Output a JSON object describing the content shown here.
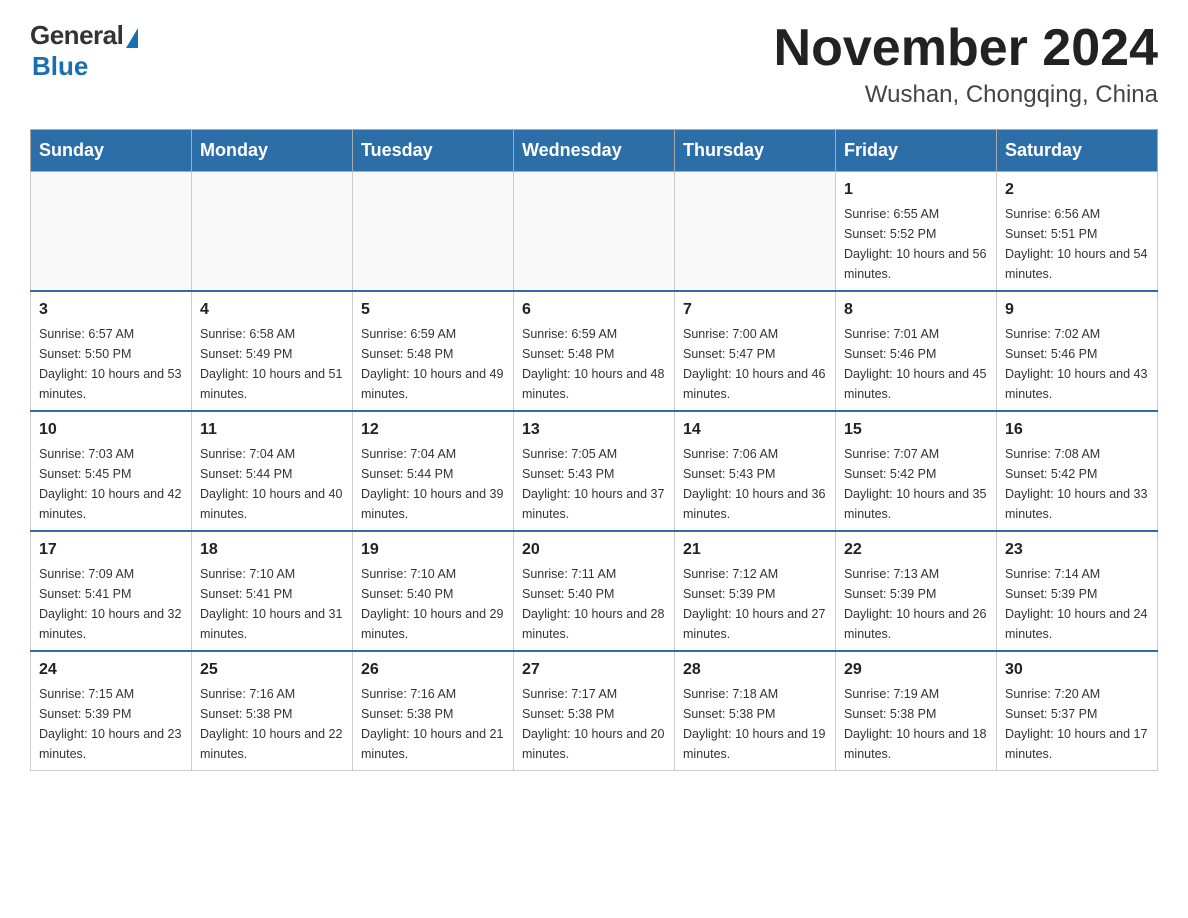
{
  "header": {
    "logo_general": "General",
    "logo_blue": "Blue",
    "month_year": "November 2024",
    "location": "Wushan, Chongqing, China"
  },
  "days_of_week": [
    "Sunday",
    "Monday",
    "Tuesday",
    "Wednesday",
    "Thursday",
    "Friday",
    "Saturday"
  ],
  "weeks": [
    [
      {
        "day": "",
        "info": ""
      },
      {
        "day": "",
        "info": ""
      },
      {
        "day": "",
        "info": ""
      },
      {
        "day": "",
        "info": ""
      },
      {
        "day": "",
        "info": ""
      },
      {
        "day": "1",
        "info": "Sunrise: 6:55 AM\nSunset: 5:52 PM\nDaylight: 10 hours and 56 minutes."
      },
      {
        "day": "2",
        "info": "Sunrise: 6:56 AM\nSunset: 5:51 PM\nDaylight: 10 hours and 54 minutes."
      }
    ],
    [
      {
        "day": "3",
        "info": "Sunrise: 6:57 AM\nSunset: 5:50 PM\nDaylight: 10 hours and 53 minutes."
      },
      {
        "day": "4",
        "info": "Sunrise: 6:58 AM\nSunset: 5:49 PM\nDaylight: 10 hours and 51 minutes."
      },
      {
        "day": "5",
        "info": "Sunrise: 6:59 AM\nSunset: 5:48 PM\nDaylight: 10 hours and 49 minutes."
      },
      {
        "day": "6",
        "info": "Sunrise: 6:59 AM\nSunset: 5:48 PM\nDaylight: 10 hours and 48 minutes."
      },
      {
        "day": "7",
        "info": "Sunrise: 7:00 AM\nSunset: 5:47 PM\nDaylight: 10 hours and 46 minutes."
      },
      {
        "day": "8",
        "info": "Sunrise: 7:01 AM\nSunset: 5:46 PM\nDaylight: 10 hours and 45 minutes."
      },
      {
        "day": "9",
        "info": "Sunrise: 7:02 AM\nSunset: 5:46 PM\nDaylight: 10 hours and 43 minutes."
      }
    ],
    [
      {
        "day": "10",
        "info": "Sunrise: 7:03 AM\nSunset: 5:45 PM\nDaylight: 10 hours and 42 minutes."
      },
      {
        "day": "11",
        "info": "Sunrise: 7:04 AM\nSunset: 5:44 PM\nDaylight: 10 hours and 40 minutes."
      },
      {
        "day": "12",
        "info": "Sunrise: 7:04 AM\nSunset: 5:44 PM\nDaylight: 10 hours and 39 minutes."
      },
      {
        "day": "13",
        "info": "Sunrise: 7:05 AM\nSunset: 5:43 PM\nDaylight: 10 hours and 37 minutes."
      },
      {
        "day": "14",
        "info": "Sunrise: 7:06 AM\nSunset: 5:43 PM\nDaylight: 10 hours and 36 minutes."
      },
      {
        "day": "15",
        "info": "Sunrise: 7:07 AM\nSunset: 5:42 PM\nDaylight: 10 hours and 35 minutes."
      },
      {
        "day": "16",
        "info": "Sunrise: 7:08 AM\nSunset: 5:42 PM\nDaylight: 10 hours and 33 minutes."
      }
    ],
    [
      {
        "day": "17",
        "info": "Sunrise: 7:09 AM\nSunset: 5:41 PM\nDaylight: 10 hours and 32 minutes."
      },
      {
        "day": "18",
        "info": "Sunrise: 7:10 AM\nSunset: 5:41 PM\nDaylight: 10 hours and 31 minutes."
      },
      {
        "day": "19",
        "info": "Sunrise: 7:10 AM\nSunset: 5:40 PM\nDaylight: 10 hours and 29 minutes."
      },
      {
        "day": "20",
        "info": "Sunrise: 7:11 AM\nSunset: 5:40 PM\nDaylight: 10 hours and 28 minutes."
      },
      {
        "day": "21",
        "info": "Sunrise: 7:12 AM\nSunset: 5:39 PM\nDaylight: 10 hours and 27 minutes."
      },
      {
        "day": "22",
        "info": "Sunrise: 7:13 AM\nSunset: 5:39 PM\nDaylight: 10 hours and 26 minutes."
      },
      {
        "day": "23",
        "info": "Sunrise: 7:14 AM\nSunset: 5:39 PM\nDaylight: 10 hours and 24 minutes."
      }
    ],
    [
      {
        "day": "24",
        "info": "Sunrise: 7:15 AM\nSunset: 5:39 PM\nDaylight: 10 hours and 23 minutes."
      },
      {
        "day": "25",
        "info": "Sunrise: 7:16 AM\nSunset: 5:38 PM\nDaylight: 10 hours and 22 minutes."
      },
      {
        "day": "26",
        "info": "Sunrise: 7:16 AM\nSunset: 5:38 PM\nDaylight: 10 hours and 21 minutes."
      },
      {
        "day": "27",
        "info": "Sunrise: 7:17 AM\nSunset: 5:38 PM\nDaylight: 10 hours and 20 minutes."
      },
      {
        "day": "28",
        "info": "Sunrise: 7:18 AM\nSunset: 5:38 PM\nDaylight: 10 hours and 19 minutes."
      },
      {
        "day": "29",
        "info": "Sunrise: 7:19 AM\nSunset: 5:38 PM\nDaylight: 10 hours and 18 minutes."
      },
      {
        "day": "30",
        "info": "Sunrise: 7:20 AM\nSunset: 5:37 PM\nDaylight: 10 hours and 17 minutes."
      }
    ]
  ]
}
